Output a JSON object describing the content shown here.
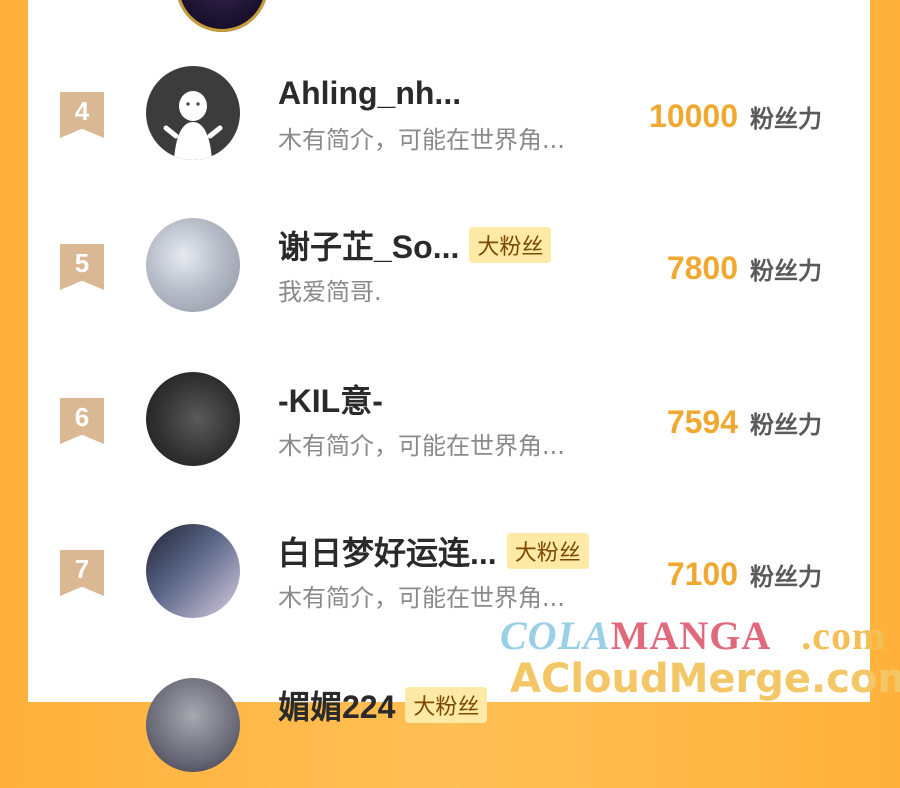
{
  "colors": {
    "accent_score": "#f0a830",
    "rank_badge": "#d9b893",
    "fan_badge_bg": "#ffe9a6",
    "background": "#ffb13a"
  },
  "unit_label": "粉丝力",
  "rows": [
    {
      "rank": "4",
      "name": "Ahling_nh...",
      "badge": "",
      "bio": "木有简介，可能在世界角...",
      "score": "10000",
      "avatar_icon": "default-user-icon"
    },
    {
      "rank": "5",
      "name": "谢子芷_So...",
      "badge": "大粉丝",
      "bio": "我爱简哥.",
      "score": "7800",
      "avatar_icon": "avatar-image"
    },
    {
      "rank": "6",
      "name": "-KIL意-",
      "badge": "",
      "bio": "木有简介，可能在世界角...",
      "score": "7594",
      "avatar_icon": "avatar-image"
    },
    {
      "rank": "7",
      "name": "白日梦好运连...",
      "badge": "大粉丝",
      "bio": "木有简介，可能在世界角...",
      "score": "7100",
      "avatar_icon": "avatar-image"
    },
    {
      "rank": "",
      "name": "媚媚224",
      "badge": "大粉丝",
      "bio": "",
      "score": "",
      "avatar_icon": "avatar-image"
    }
  ],
  "watermark": {
    "line1_a": "COLA",
    "line1_b": "MANGA",
    "line1_c": ".com",
    "line2": "ACloudMerge.com"
  }
}
